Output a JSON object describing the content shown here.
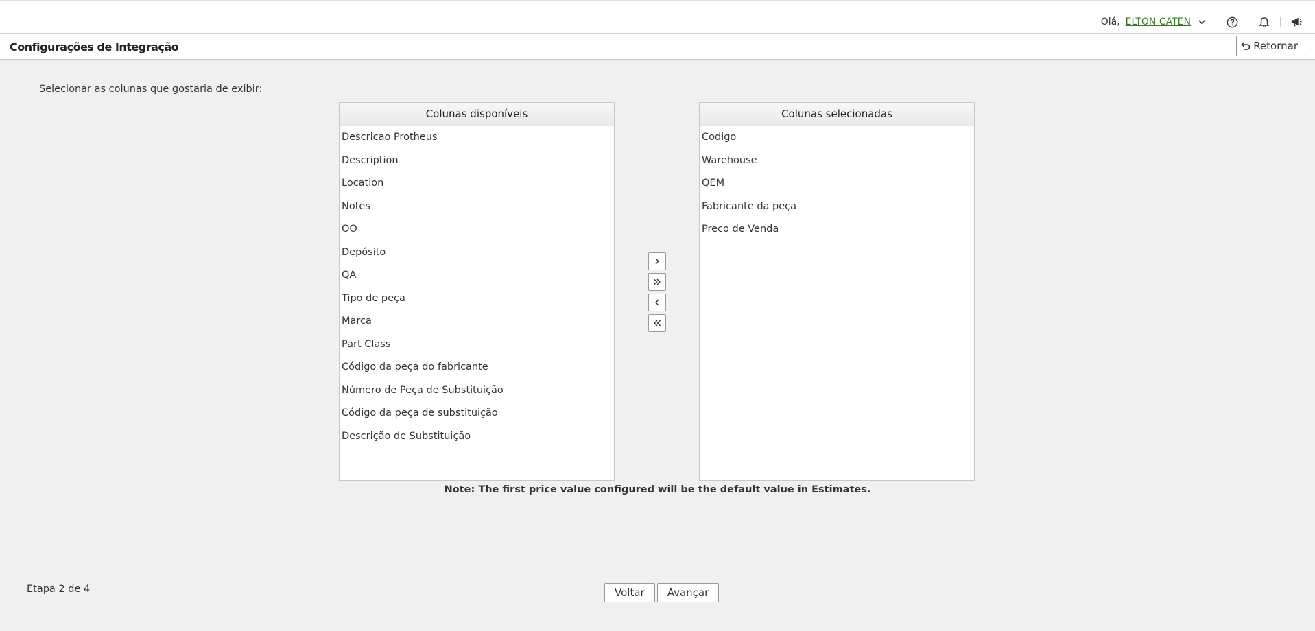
{
  "header": {
    "greeting": "Olá,",
    "username": "ELTON CATEN"
  },
  "titlebar": {
    "title": "Configurações de Integração",
    "back_label": "Retornar"
  },
  "instruction": "Selecionar as colunas que gostaria de exibir:",
  "available": {
    "header": "Colunas disponíveis",
    "items": [
      "Descricao Protheus",
      "Description",
      "Location",
      "Notes",
      "OO",
      "Depósito",
      "QA",
      "Tipo de peça",
      "Marca",
      "Part Class",
      "Código da peça do fabricante",
      "Número de Peça de Substituição",
      "Código da peça de substituição",
      "Descrição de Substituição"
    ]
  },
  "selected": {
    "header": "Colunas selecionadas",
    "items": [
      "Codigo",
      "Warehouse",
      "QEM",
      "Fabricante da peça",
      "Preco de Venda"
    ]
  },
  "move_buttons": [
    "chevron-right-icon",
    "double-chevron-right-icon",
    "chevron-left-icon",
    "double-chevron-left-icon"
  ],
  "note": "Note: The first price value configured will be the default value in Estimates.",
  "footer": {
    "step": "Etapa 2 de 4",
    "back_label": "Voltar",
    "next_label": "Avançar"
  },
  "colors": {
    "background": "#f0f0f0",
    "link_green": "#3b7a2b"
  }
}
